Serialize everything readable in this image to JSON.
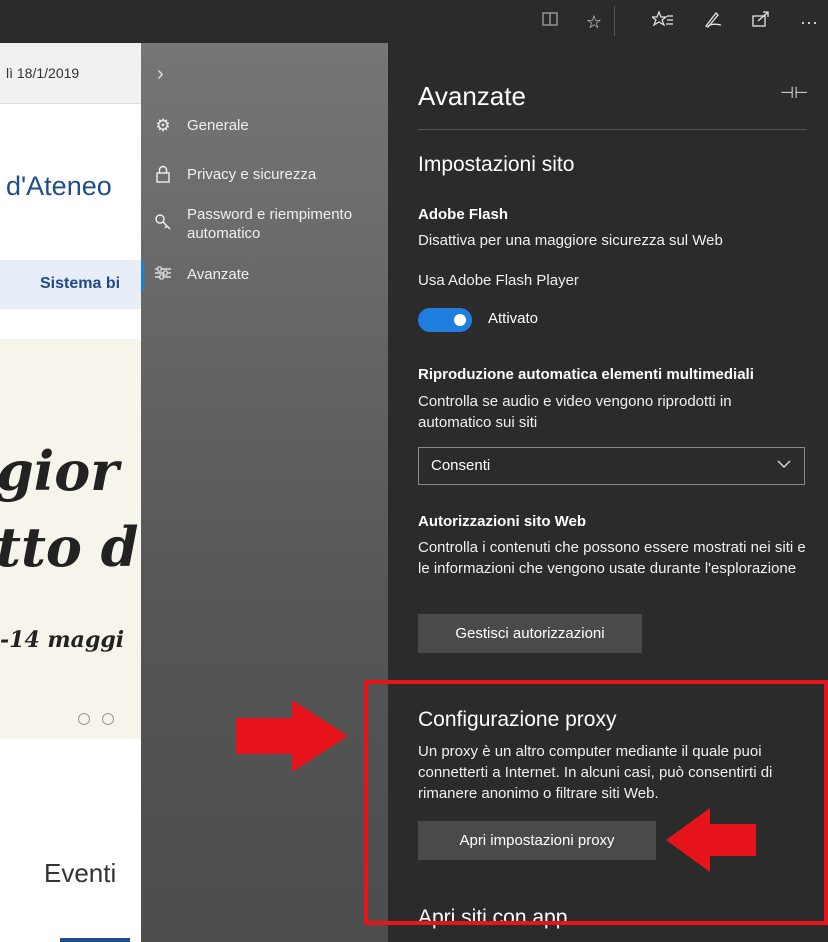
{
  "toolbar": {
    "icons": [
      "reading-view-icon",
      "favorite-star-icon",
      "favorites-hub-icon",
      "pen-icon",
      "share-icon",
      "more-icon"
    ]
  },
  "page": {
    "date": "lì 18/1/2019",
    "heading": "d'Ateneo",
    "button": "Sistema bi",
    "banner_lines": [
      "gior",
      "tto d",
      "-14 maggi"
    ],
    "events_heading": "Eventi"
  },
  "nav": {
    "items": [
      {
        "label": "Generale",
        "icon": "gear-icon"
      },
      {
        "label": "Privacy e sicurezza",
        "icon": "lock-icon"
      },
      {
        "label": "Password e riempimento automatico",
        "icon": "key-icon"
      },
      {
        "label": "Avanzate",
        "icon": "sliders-icon",
        "active": true
      }
    ]
  },
  "panel": {
    "title": "Avanzate",
    "site_settings": {
      "heading": "Impostazioni sito",
      "flash_title": "Adobe Flash",
      "flash_desc": "Disattiva per una maggiore sicurezza sul Web",
      "flash_use_label": "Usa Adobe Flash Player",
      "flash_toggle_state": "Attivato",
      "autoplay_title": "Riproduzione automatica elementi multimediali",
      "autoplay_desc": "Controlla se audio e video vengono riprodotti in automatico sui siti",
      "autoplay_value": "Consenti",
      "perm_title": "Autorizzazioni sito Web",
      "perm_desc": "Controlla i contenuti che possono essere mostrati nei siti e le informazioni che vengono usate durante l'esplorazione",
      "perm_button": "Gestisci autorizzazioni"
    },
    "proxy": {
      "heading": "Configurazione proxy",
      "desc": "Un proxy è un altro computer mediante il quale puoi connetterti a Internet. In alcuni casi, può consentirti di rimanere anonimo o filtrare siti Web.",
      "button": "Apri impostazioni proxy"
    },
    "open_sites": {
      "heading": "Apri siti con app"
    }
  },
  "colors": {
    "accent": "#1e7fe0",
    "highlight_red": "#e8141c",
    "panel_bg": "#2b2b2b"
  }
}
